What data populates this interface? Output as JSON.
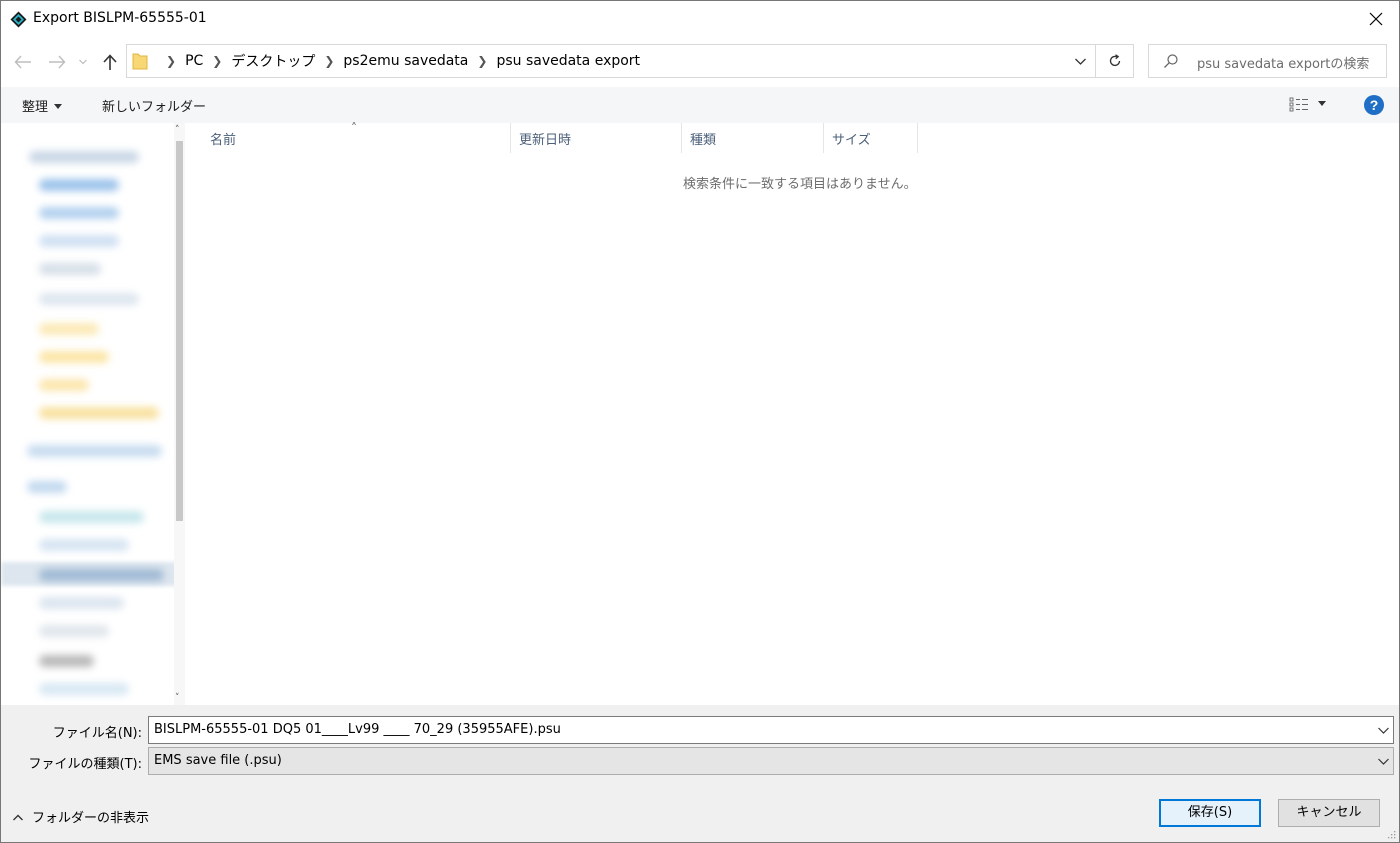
{
  "window": {
    "title": "Export BISLPM-65555-01",
    "accent_color": "#0078d7"
  },
  "address": {
    "crumbs": [
      "PC",
      "デスクトップ",
      "ps2emu savedata",
      "psu savedata export"
    ],
    "search_placeholder": "psu savedata exportの検索"
  },
  "toolbar": {
    "organize_label": "整理",
    "new_folder_label": "新しいフォルダー",
    "help_label": "?"
  },
  "file_list": {
    "columns": [
      "名前",
      "更新日時",
      "種類",
      "サイズ"
    ],
    "empty_message": "検索条件に一致する項目はありません。"
  },
  "form": {
    "filename_label": "ファイル名(N):",
    "filename_value": "BISLPM-65555-01 DQ5 01____Lv99 ____ 70_29 (35955AFE).psu",
    "filetype_label": "ファイルの種類(T):",
    "filetype_value": "EMS save file (.psu)"
  },
  "footer": {
    "hide_folders_label": "フォルダーの非表示",
    "save_label": "保存(S)",
    "cancel_label": "キャンセル"
  }
}
